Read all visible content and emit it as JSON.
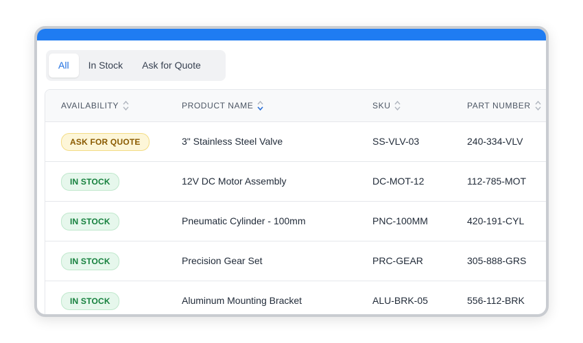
{
  "tabs": [
    {
      "label": "All",
      "active": true
    },
    {
      "label": "In Stock",
      "active": false
    },
    {
      "label": "Ask for Quote",
      "active": false
    }
  ],
  "columns": [
    {
      "label": "AVAILABILITY",
      "sort": "none"
    },
    {
      "label": "PRODUCT NAME",
      "sort": "active"
    },
    {
      "label": "SKU",
      "sort": "none"
    },
    {
      "label": "PART NUMBER",
      "sort": "none"
    }
  ],
  "rows": [
    {
      "availability": "ASK FOR QUOTE",
      "status": "quote",
      "product": "3\" Stainless Steel Valve",
      "sku": "SS-VLV-03",
      "part": "240-334-VLV"
    },
    {
      "availability": "IN STOCK",
      "status": "stock",
      "product": "12V DC Motor Assembly",
      "sku": "DC-MOT-12",
      "part": "112-785-MOT"
    },
    {
      "availability": "IN STOCK",
      "status": "stock",
      "product": "Pneumatic Cylinder - 100mm",
      "sku": "PNC-100MM",
      "part": "420-191-CYL"
    },
    {
      "availability": "IN STOCK",
      "status": "stock",
      "product": "Precision Gear Set",
      "sku": "PRC-GEAR",
      "part": "305-888-GRS"
    },
    {
      "availability": "IN STOCK",
      "status": "stock",
      "product": "Aluminum Mounting Bracket",
      "sku": "ALU-BRK-05",
      "part": "556-112-BRK"
    }
  ],
  "colors": {
    "accent": "#1f7cf2",
    "sort_active": "#2b6fd6",
    "sort_inactive": "#b0b6bf"
  }
}
